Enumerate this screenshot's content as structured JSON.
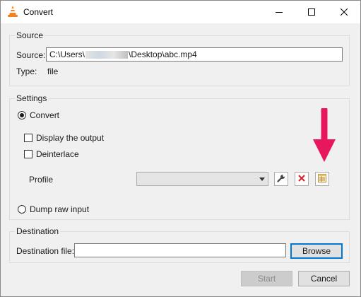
{
  "window": {
    "title": "Convert",
    "icon": "vlc-cone-icon",
    "minimize_icon": "minimize-icon",
    "maximize_icon": "maximize-icon",
    "close_icon": "close-icon"
  },
  "source": {
    "group_label": "Source",
    "source_label": "Source:",
    "source_path_start": "C:\\Users\\",
    "source_path_end": "\\Desktop\\abc.mp4",
    "type_label": "Type:",
    "type_value": "file"
  },
  "settings": {
    "group_label": "Settings",
    "convert_label": "Convert",
    "convert_selected": true,
    "display_output_label": "Display the output",
    "display_output_checked": false,
    "deinterlace_label": "Deinterlace",
    "deinterlace_checked": false,
    "profile_label": "Profile",
    "profile_value": "",
    "edit_profile_icon": "wrench-icon",
    "delete_profile_icon": "red-x-icon",
    "new_profile_icon": "new-profile-icon",
    "dump_raw_label": "Dump raw input",
    "dump_raw_selected": false,
    "annotation_color": "#e8175d"
  },
  "destination": {
    "group_label": "Destination",
    "file_label": "Destination file:",
    "file_value": "",
    "browse_label": "Browse"
  },
  "footer": {
    "start_label": "Start",
    "cancel_label": "Cancel"
  }
}
